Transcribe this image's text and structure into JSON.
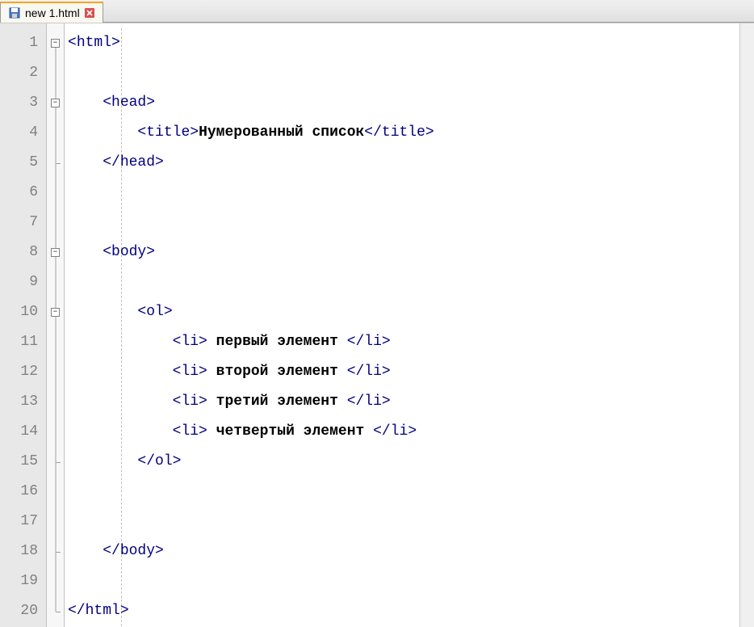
{
  "tab": {
    "filename": "new  1.html",
    "icon": "file-save-icon",
    "close_icon": "close-icon"
  },
  "lines": {
    "count": 20,
    "numbers": [
      "1",
      "2",
      "3",
      "4",
      "5",
      "6",
      "7",
      "8",
      "9",
      "10",
      "11",
      "12",
      "13",
      "14",
      "15",
      "16",
      "17",
      "18",
      "19",
      "20"
    ]
  },
  "code": {
    "l1": {
      "pre": "",
      "open": "<",
      "tag": "html",
      "close": ">"
    },
    "l3": {
      "pre": "    ",
      "open": "<",
      "tag": "head",
      "close": ">"
    },
    "l4": {
      "pre": "        ",
      "open1": "<",
      "tag1": "title",
      "close1": ">",
      "text": "Нумерованный список",
      "open2": "</",
      "tag2": "title",
      "close2": ">"
    },
    "l5": {
      "pre": "    ",
      "open": "</",
      "tag": "head",
      "close": ">"
    },
    "l8": {
      "pre": "    ",
      "open": "<",
      "tag": "body",
      "close": ">"
    },
    "l10": {
      "pre": "        ",
      "open": "<",
      "tag": "ol",
      "close": ">"
    },
    "l11": {
      "pre": "            ",
      "open1": "<",
      "tag1": "li",
      "close1": ">",
      "text": " первый элемент ",
      "open2": "</",
      "tag2": "li",
      "close2": ">"
    },
    "l12": {
      "pre": "            ",
      "open1": "<",
      "tag1": "li",
      "close1": ">",
      "text": " второй элемент ",
      "open2": "</",
      "tag2": "li",
      "close2": ">"
    },
    "l13": {
      "pre": "            ",
      "open1": "<",
      "tag1": "li",
      "close1": ">",
      "text": " третий элемент ",
      "open2": "</",
      "tag2": "li",
      "close2": ">"
    },
    "l14": {
      "pre": "            ",
      "open1": "<",
      "tag1": "li",
      "close1": ">",
      "text": " четвертый элемент ",
      "open2": "</",
      "tag2": "li",
      "close2": ">"
    },
    "l15": {
      "pre": "        ",
      "open": "</",
      "tag": "ol",
      "close": ">"
    },
    "l18": {
      "pre": "    ",
      "open": "</",
      "tag": "body",
      "close": ">"
    },
    "l20": {
      "pre": "",
      "open": "</",
      "tag": "html",
      "close": ">"
    }
  },
  "fold": {
    "minus": "−"
  }
}
